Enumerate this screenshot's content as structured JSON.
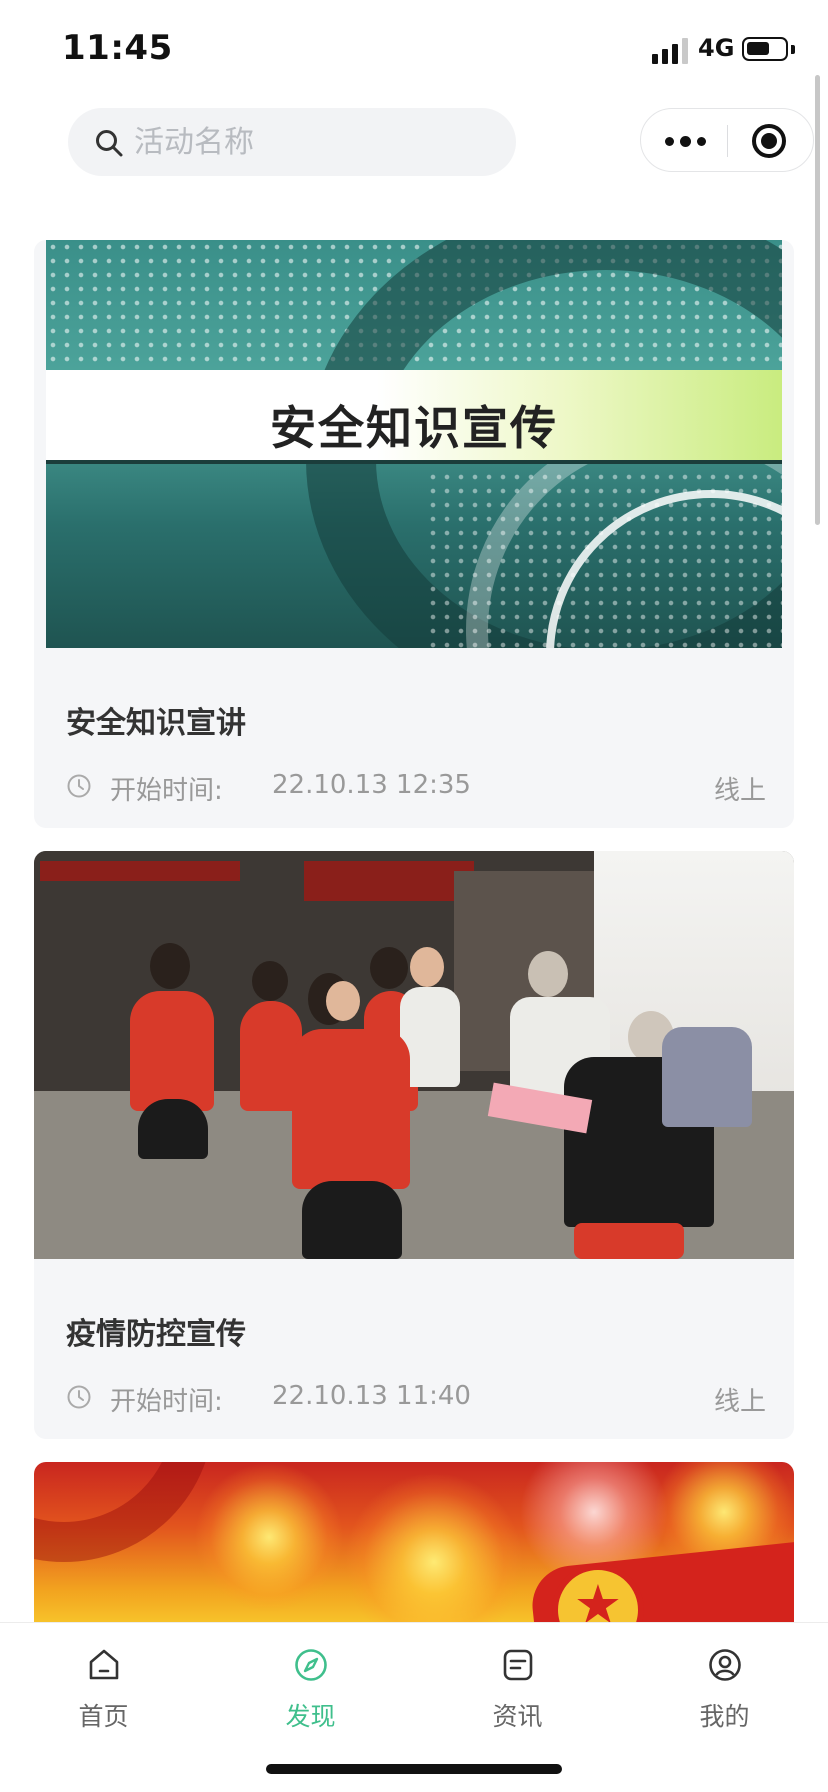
{
  "status_bar": {
    "time": "11:45",
    "network": "4G",
    "battery_level": 0.6
  },
  "search": {
    "placeholder": "活动名称"
  },
  "activities": [
    {
      "title": "安全知识宣讲",
      "image_text": "安全知识宣传",
      "start_label": "开始时间:",
      "start_time": "22.10.13 12:35",
      "mode": "线上"
    },
    {
      "title": "疫情防控宣传",
      "start_label": "开始时间:",
      "start_time": "22.10.13 11:40",
      "mode": "线上"
    }
  ],
  "tabbar": {
    "items": [
      {
        "label": "首页",
        "icon": "home-icon"
      },
      {
        "label": "发现",
        "icon": "compass-icon",
        "active": true
      },
      {
        "label": "资讯",
        "icon": "news-icon"
      },
      {
        "label": "我的",
        "icon": "user-icon"
      }
    ]
  },
  "colors": {
    "accent": "#3fbf8c",
    "card_bg": "#f5f6f8",
    "muted_text": "#999999"
  }
}
